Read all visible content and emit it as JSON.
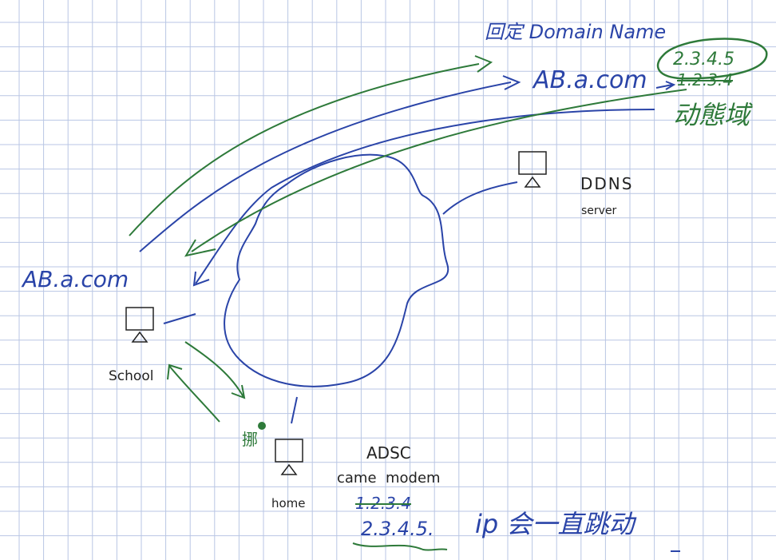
{
  "title_label": "回定 Domain Name",
  "domain_top": "AB.a.com",
  "ip_new_circled": "2.3.4.5",
  "ip_old_struck": "1.2.3.4",
  "dynamic_domain_label": "动態域",
  "ddns": {
    "name": "DDNS",
    "sub": "server"
  },
  "domain_left": "AB.a.com",
  "school_label": "School",
  "home_label": "home",
  "home_note": "挪",
  "modem": {
    "line1": "ADSC",
    "line2": "came  modem"
  },
  "home_ip_old": "1.2.3.4",
  "home_ip_new": "2.3.4.5.",
  "ip_note": "ip 会一直跳动",
  "colors": {
    "grid": "#b9c6e4",
    "blue": "#2a44a8",
    "green": "#2e7a3a",
    "black": "#222222"
  }
}
